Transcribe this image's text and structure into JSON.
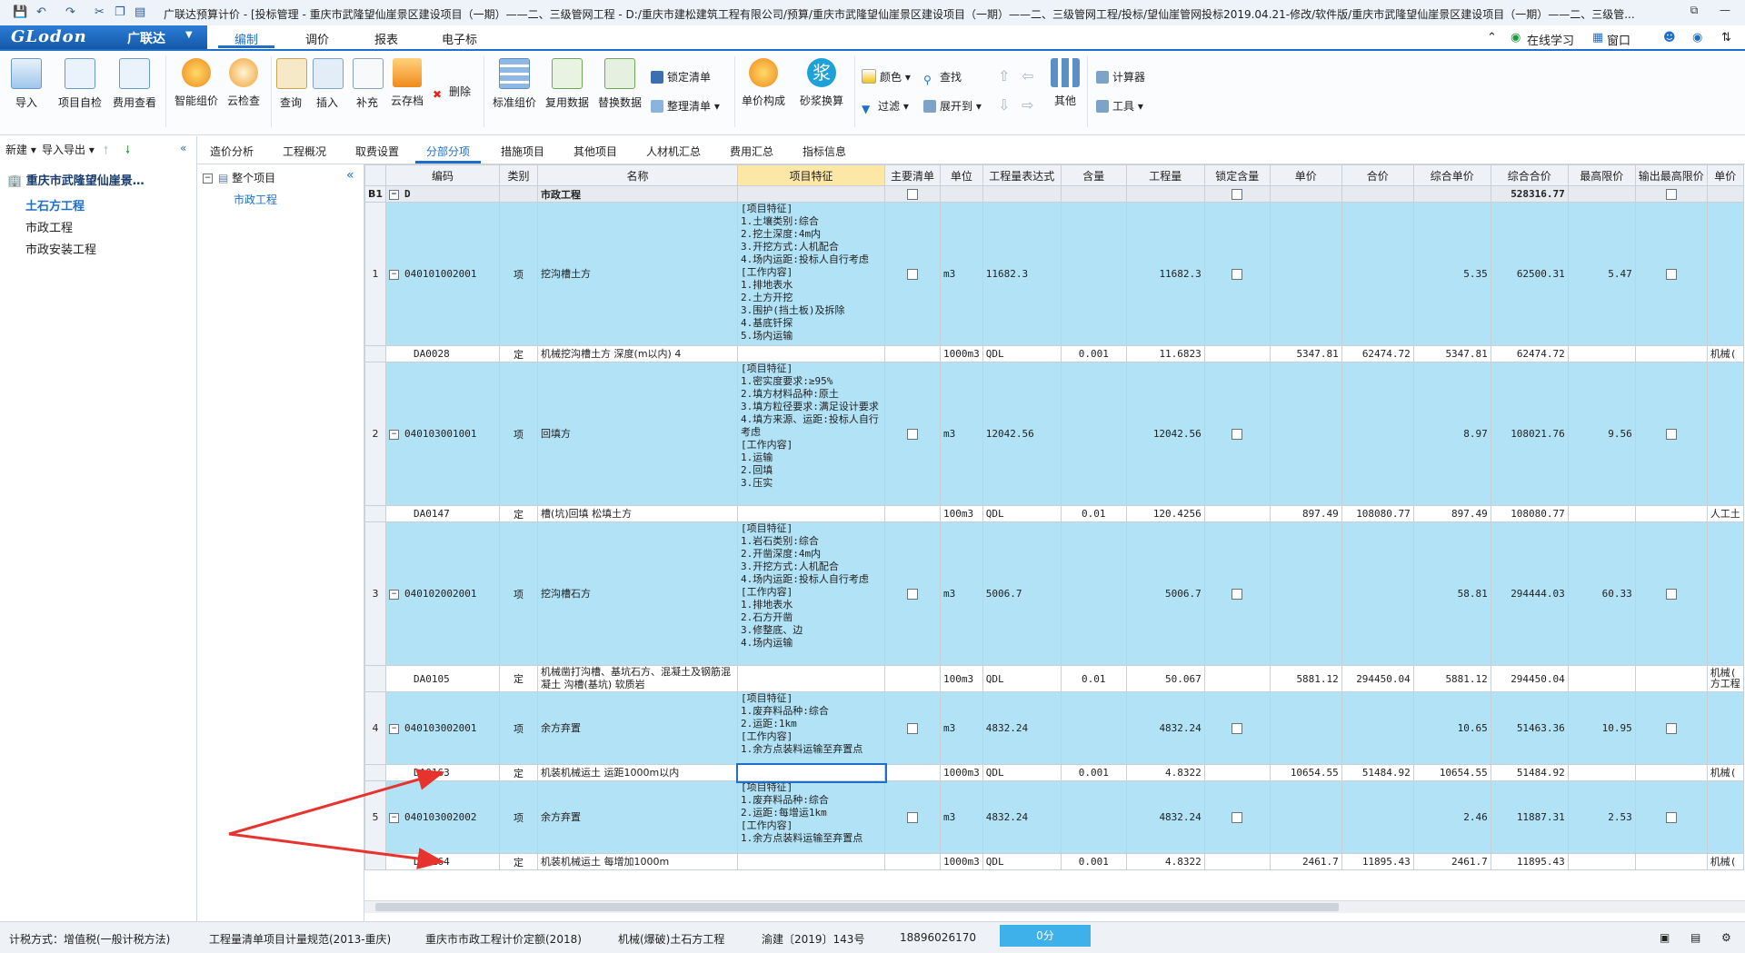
{
  "titlebar": {
    "text": "广联达预算计价 - [投标管理 - 重庆市武隆望仙崖景区建设项目（一期）——二、三级管网工程 - D:/重庆市建松建筑工程有限公司/预算/重庆市武隆望仙崖景区建设项目（一期）——二、三级管网工程/投标/望仙崖管网投标2019.04.21-修改/软件版/重庆市武隆望仙崖景区建设项目（一期）——二、三级管..."
  },
  "menubar": {
    "logo": "GLodon",
    "logo_cn": "广联达",
    "tabs": [
      "编制",
      "调价",
      "报表",
      "电子标"
    ],
    "right": {
      "online": "在线学习",
      "window": "窗口"
    }
  },
  "ribbon": {
    "import": "导入",
    "self_check": "项目自检",
    "fee_check": "费用查看",
    "smart_price": "智能组价",
    "cloud_check": "云检查",
    "query": "查询",
    "insert": "插入",
    "supplement": "补充",
    "cloud_save": "云存档",
    "delete": "删除",
    "std_price": "标准组价",
    "reuse_data": "复用数据",
    "replace_data": "替换数据",
    "lock_list": "锁定清单",
    "arrange_list": "整理清单",
    "unit_compose": "单价构成",
    "mortar_convert": "砂浆换算",
    "color": "颜色",
    "find": "查找",
    "filter": "过滤",
    "expand": "展开到",
    "other": "其他",
    "calculator": "计算器",
    "tools": "工具"
  },
  "leftpanel": {
    "new": "新建",
    "import_export": "导入导出",
    "project": "重庆市武隆望仙崖景…",
    "items": [
      "土石方工程",
      "市政工程",
      "市政安装工程"
    ]
  },
  "tabs": [
    "造价分析",
    "工程概况",
    "取费设置",
    "分部分项",
    "措施项目",
    "其他项目",
    "人材机汇总",
    "费用汇总",
    "指标信息"
  ],
  "tree": {
    "root": "整个项目",
    "child": "市政工程"
  },
  "grid": {
    "headers": [
      "编码",
      "类别",
      "名称",
      "项目特征",
      "主要清单",
      "单位",
      "工程量表达式",
      "含量",
      "工程量",
      "锁定含量",
      "单价",
      "合价",
      "综合单价",
      "综合合价",
      "最高限价",
      "输出最高限价",
      "单价"
    ],
    "b1": {
      "no": "B1",
      "code": "D",
      "name": "市政工程",
      "total": "528316.77"
    },
    "rows": [
      {
        "kind": "item",
        "no": "1",
        "code": "040101002001",
        "type": "项",
        "name": "挖沟槽土方",
        "feature": "[项目特征]\n1.土壤类别:综合\n2.挖土深度:4m内\n3.开挖方式:人机配合\n4.场内运距:投标人自行考虑\n[工作内容]\n1.排地表水\n2.土方开挖\n3.围护(挡土板)及拆除\n4.基底钎探\n5.场内运输",
        "unit": "m3",
        "expr": "11682.3",
        "content": "",
        "qty": "11682.3",
        "price": "",
        "amount": "",
        "uprice": "5.35",
        "total": "62500.31",
        "maxp": "5.47",
        "extra": ""
      },
      {
        "kind": "sub",
        "no": "",
        "code": "DA0028",
        "type": "定",
        "name": "机械挖沟槽土方 深度(m以内) 4",
        "feature": "",
        "unit": "1000m3",
        "expr": "QDL",
        "content": "0.001",
        "qty": "11.6823",
        "price": "5347.81",
        "amount": "62474.72",
        "uprice": "5347.81",
        "total": "62474.72",
        "maxp": "",
        "extra": "机械("
      },
      {
        "kind": "item",
        "no": "2",
        "code": "040103001001",
        "type": "项",
        "name": "回填方",
        "feature": "[项目特征]\n1.密实度要求:≥95%\n2.填方材料品种:原土\n3.填方粒径要求:满足设计要求\n4.填方来源、运距:投标人自行考虑\n[工作内容]\n1.运输\n2.回填\n3.压实",
        "unit": "m3",
        "expr": "12042.56",
        "content": "",
        "qty": "12042.56",
        "price": "",
        "amount": "",
        "uprice": "8.97",
        "total": "108021.76",
        "maxp": "9.56",
        "extra": ""
      },
      {
        "kind": "sub",
        "no": "",
        "code": "DA0147",
        "type": "定",
        "name": "槽(坑)回填 松填土方",
        "feature": "",
        "unit": "100m3",
        "expr": "QDL",
        "content": "0.01",
        "qty": "120.4256",
        "price": "897.49",
        "amount": "108080.77",
        "uprice": "897.49",
        "total": "108080.77",
        "maxp": "",
        "extra": "人工土"
      },
      {
        "kind": "item",
        "no": "3",
        "code": "040102002001",
        "type": "项",
        "name": "挖沟槽石方",
        "feature": "[项目特征]\n1.岩石类别:综合\n2.开凿深度:4m内\n3.开挖方式:人机配合\n4.场内运距:投标人自行考虑\n[工作内容]\n1.排地表水\n2.石方开凿\n3.修整底、边\n4.场内运输",
        "unit": "m3",
        "expr": "5006.7",
        "content": "",
        "qty": "5006.7",
        "price": "",
        "amount": "",
        "uprice": "58.81",
        "total": "294444.03",
        "maxp": "60.33",
        "extra": ""
      },
      {
        "kind": "sub",
        "no": "",
        "code": "DA0105",
        "type": "定",
        "name": "机械凿打沟槽、基坑石方、混凝土及钢筋混凝土 沟槽(基坑) 软质岩",
        "feature": "",
        "unit": "100m3",
        "expr": "QDL",
        "content": "0.01",
        "qty": "50.067",
        "price": "5881.12",
        "amount": "294450.04",
        "uprice": "5881.12",
        "total": "294450.04",
        "maxp": "",
        "extra": "机械(\n方工程"
      },
      {
        "kind": "item",
        "no": "4",
        "code": "040103002001",
        "type": "项",
        "name": "余方弃置",
        "feature": "[项目特征]\n1.废弃料品种:综合\n2.运距:1km\n[工作内容]\n1.余方点装料运输至弃置点",
        "unit": "m3",
        "expr": "4832.24",
        "content": "",
        "qty": "4832.24",
        "price": "",
        "amount": "",
        "uprice": "10.65",
        "total": "51463.36",
        "maxp": "10.95",
        "extra": ""
      },
      {
        "kind": "sub",
        "no": "",
        "code": "DA0163",
        "type": "定",
        "name": "机装机械运土 运距1000m以内",
        "feature": "",
        "unit": "1000m3",
        "expr": "QDL",
        "content": "0.001",
        "qty": "4.8322",
        "price": "10654.55",
        "amount": "51484.92",
        "uprice": "10654.55",
        "total": "51484.92",
        "maxp": "",
        "extra": "机械("
      },
      {
        "kind": "item",
        "no": "5",
        "code": "040103002002",
        "type": "项",
        "name": "余方弃置",
        "feature": "[项目特征]\n1.废弃料品种:综合\n2.运距:每增运1km\n[工作内容]\n1.余方点装料运输至弃置点",
        "unit": "m3",
        "expr": "4832.24",
        "content": "",
        "qty": "4832.24",
        "price": "",
        "amount": "",
        "uprice": "2.46",
        "total": "11887.31",
        "maxp": "2.53",
        "extra": ""
      },
      {
        "kind": "sub",
        "no": "",
        "code": "DA0164",
        "type": "定",
        "name": "机装机械运土 每增加1000m",
        "feature": "",
        "unit": "1000m3",
        "expr": "QDL",
        "content": "0.001",
        "qty": "4.8322",
        "price": "2461.7",
        "amount": "11895.43",
        "uprice": "2461.7",
        "total": "11895.43",
        "maxp": "",
        "extra": "机械("
      }
    ]
  },
  "statusbar": {
    "tax": "计税方式：增值税(一般计税方法)",
    "spec": "工程量清单项目计量规范(2013-重庆)",
    "quota": "重庆市市政工程计价定额(2018)",
    "section": "机械(爆破)土石方工程",
    "doc": "渝建〔2019〕143号",
    "phone": "18896026170",
    "score": "0分"
  },
  "colors": {
    "accent": "#1e6fc8",
    "item_row": "#b1e2f6",
    "feature_header": "#fde7a6",
    "arrow": "#e8322d"
  }
}
